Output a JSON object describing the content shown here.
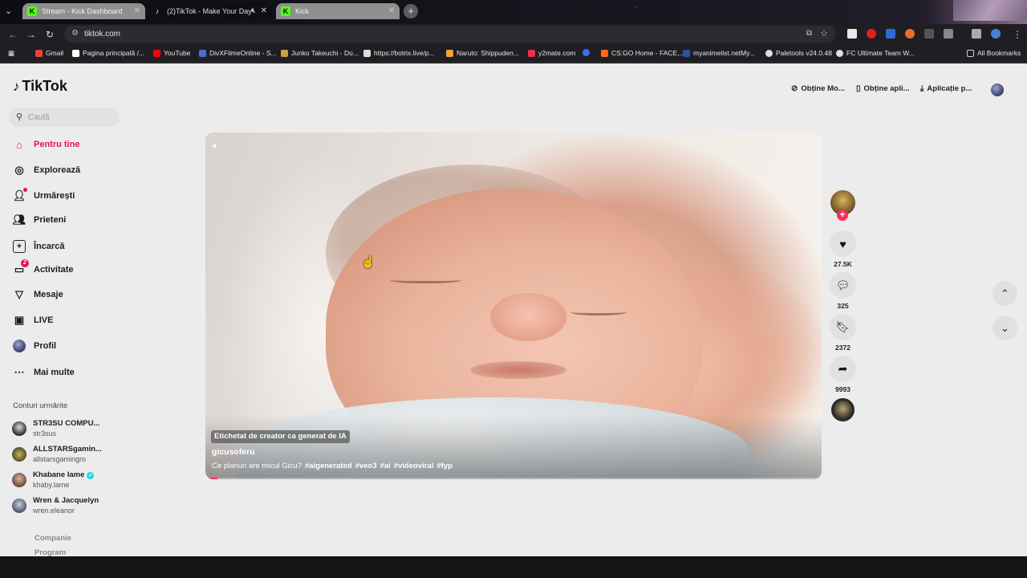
{
  "browser": {
    "tabs": [
      {
        "title": "Stream - Kick Dashboard",
        "favicon": "K"
      },
      {
        "title": "(2)TikTok - Make Your Day",
        "favicon": "♪"
      },
      {
        "title": "Kick",
        "favicon": "K"
      }
    ],
    "url": "tiktok.com",
    "bookmarks": [
      {
        "label": "Gmail",
        "color": "#ea4335"
      },
      {
        "label": "Pagina principală /...",
        "color": "#ffffff"
      },
      {
        "label": "YouTube",
        "color": "#ff0000"
      },
      {
        "label": "DivXFilmeOnline - S...",
        "color": "#4a6cd4"
      },
      {
        "label": "Junko Takeuchi - Do...",
        "color": "#c5a14a"
      },
      {
        "label": "https://botrix.live/p...",
        "color": "#dddddd"
      },
      {
        "label": "Naruto: Shippuden...",
        "color": "#f2a33a"
      },
      {
        "label": "y2mate.com",
        "color": "#e8304a"
      },
      {
        "label": "",
        "color": "#3a6ff0"
      },
      {
        "label": "CS:GO Home - FACE...",
        "color": "#ff6a1a"
      },
      {
        "label": "myanimelist.netMy...",
        "color": "#2e51a2"
      },
      {
        "label": "Paletools v24.0.48",
        "color": "#dddddd"
      },
      {
        "label": "FC Ultimate Team W...",
        "color": "#dddddd"
      }
    ],
    "all_bookmarks": "All Bookmarks"
  },
  "tiktok": {
    "brand": "TikTok",
    "search_placeholder": "Caută",
    "nav": [
      {
        "label": "Pentru tine",
        "icon": "home-icon"
      },
      {
        "label": "Explorează",
        "icon": "compass-icon"
      },
      {
        "label": "Urmărești",
        "icon": "following-icon"
      },
      {
        "label": "Prieteni",
        "icon": "friends-icon"
      },
      {
        "label": "Încarcă",
        "icon": "upload-icon"
      },
      {
        "label": "Activitate",
        "icon": "activity-icon",
        "badge": "2"
      },
      {
        "label": "Mesaje",
        "icon": "messages-icon"
      },
      {
        "label": "LIVE",
        "icon": "live-icon"
      },
      {
        "label": "Profil",
        "icon": "profile-icon"
      },
      {
        "label": "Mai multe",
        "icon": "more-icon"
      }
    ],
    "following_title": "Conturi urmărite",
    "following": [
      {
        "name": "STR3SU COMPU...",
        "handle": "str3sus",
        "verified": false
      },
      {
        "name": "ALLSTARSgamin...",
        "handle": "allstarsgamingro",
        "verified": false
      },
      {
        "name": "Khabane lame",
        "handle": "khaby.lame",
        "verified": true
      },
      {
        "name": "Wren & Jacquelyn",
        "handle": "wren.eleanor",
        "verified": false
      }
    ],
    "footer": [
      "Companie",
      "Program"
    ],
    "header_buttons": [
      "Obține Mo...",
      "Obține apli...",
      "Aplicație p..."
    ],
    "video": {
      "ai_label": "Etichetat de creator ca generat de IA",
      "author": "gicusoferu",
      "caption_text": "Ce planuri are micul Gicu?",
      "hashtags": [
        "#aigenerated",
        "#veo3",
        "#ai",
        "#videoviral",
        "#fyp"
      ],
      "progress": 0.02
    },
    "actions": {
      "likes": "27.5K",
      "comments": "325",
      "saves": "2372",
      "shares": "9993"
    },
    "accent": "#fe2c55"
  }
}
